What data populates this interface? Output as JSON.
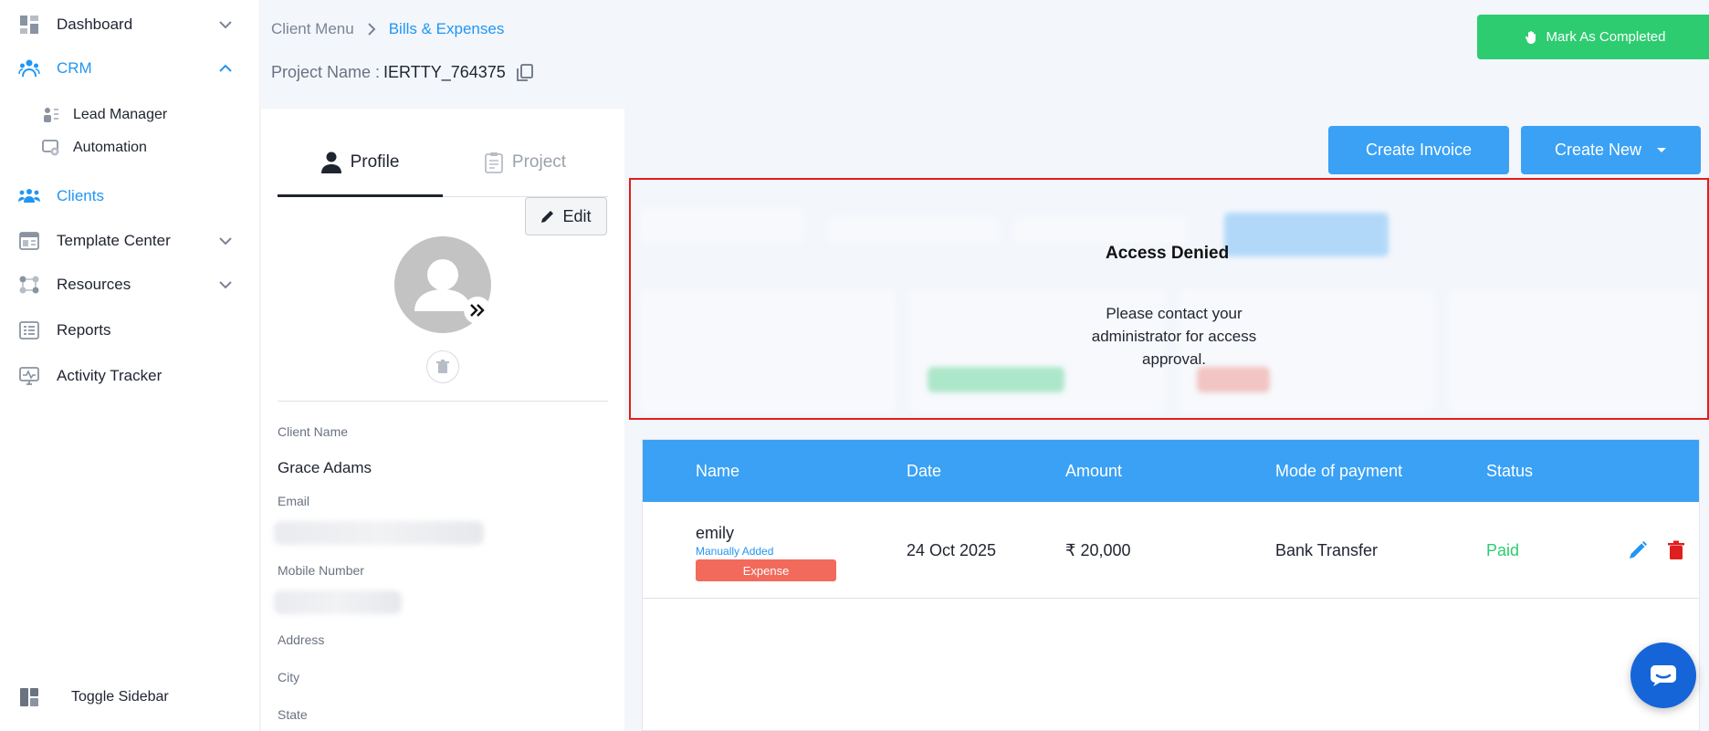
{
  "sidebar": {
    "items": [
      {
        "label": "Dashboard"
      },
      {
        "label": "CRM"
      },
      {
        "label": "Lead Manager"
      },
      {
        "label": "Automation"
      },
      {
        "label": "Clients"
      },
      {
        "label": "Template Center"
      },
      {
        "label": "Resources"
      },
      {
        "label": "Reports"
      },
      {
        "label": "Activity Tracker"
      }
    ],
    "toggle_label": "Toggle Sidebar"
  },
  "header": {
    "breadcrumb": [
      "Client Menu",
      "Bills & Expenses"
    ],
    "project_label": "Project Name :",
    "project_value": "IERTTY_764375",
    "mark_completed": "Mark As Completed"
  },
  "profile": {
    "tabs": [
      "Profile",
      "Project"
    ],
    "edit_label": "Edit",
    "fields": {
      "client_name_label": "Client Name",
      "client_name_value": "Grace Adams",
      "email_label": "Email",
      "mobile_label": "Mobile Number",
      "address_label": "Address",
      "city_label": "City",
      "state_label": "State"
    }
  },
  "actions": {
    "create_invoice": "Create Invoice",
    "create_new": "Create New"
  },
  "access": {
    "title": "Access Denied",
    "message": "Please contact your administrator for access approval."
  },
  "table": {
    "headers": [
      "Name",
      "Date",
      "Amount",
      "Mode of payment",
      "Status"
    ],
    "rows": [
      {
        "name": "emily",
        "source": "Manually Added",
        "type": "Expense",
        "date": "24 Oct 2025",
        "amount": "₹ 20,000",
        "mode": "Bank Transfer",
        "status": "Paid"
      }
    ]
  },
  "colors": {
    "accent": "#3aa1f5",
    "success": "#2ecc71",
    "danger": "#e01e1e",
    "expense": "#f26a5c"
  }
}
